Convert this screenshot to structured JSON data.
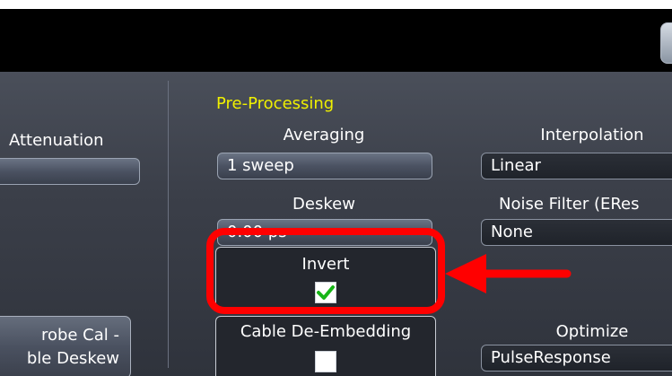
{
  "header": {},
  "left_panel": {
    "attenuation_label": "Attenuation",
    "probe_cal_line1": "robe Cal -",
    "probe_cal_line2": "ble Deskew"
  },
  "pre_processing": {
    "section_title": "Pre-Processing",
    "averaging_label": "Averaging",
    "averaging_value": "1 sweep",
    "deskew_label": "Deskew",
    "deskew_value": "0.00 ps",
    "invert_label": "Invert",
    "invert_checked": true,
    "cable_deembedding_label": "Cable De-Embedding",
    "cable_deembedding_checked": false
  },
  "right_panel": {
    "interpolation_label": "Interpolation",
    "interpolation_value": "Linear",
    "noise_filter_label": "Noise Filter (ERes",
    "noise_filter_value": "None",
    "optimize_label": "Optimize",
    "optimize_value": "PulseResponse"
  },
  "annotation": {
    "highlight_color": "#ff0000",
    "arrow_color": "#ff0000"
  }
}
